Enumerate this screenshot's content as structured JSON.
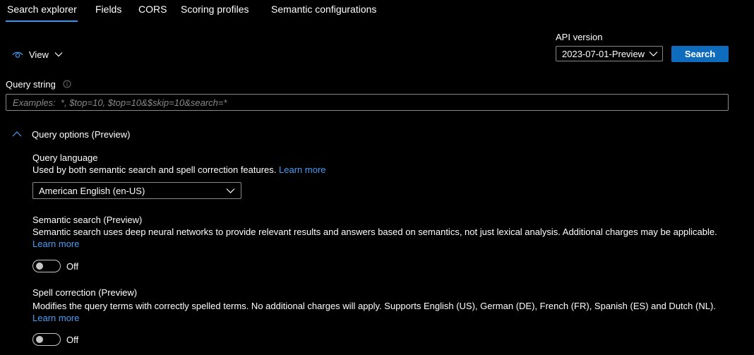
{
  "tabs": [
    {
      "label": "Search explorer",
      "active": true
    },
    {
      "label": "Fields"
    },
    {
      "label": "CORS"
    },
    {
      "label": "Scoring profiles"
    },
    {
      "label": "Semantic configurations"
    }
  ],
  "view": {
    "label": "View",
    "icon": "eye-icon"
  },
  "api": {
    "label": "API version",
    "selected": "2023-07-01-Preview",
    "search_label": "Search"
  },
  "query_string": {
    "label": "Query string",
    "placeholder": "Examples:  *, $top=10, $top=10&$skip=10&search=*"
  },
  "query_options": {
    "title": "Query options (Preview)",
    "language": {
      "title": "Query language",
      "desc": "Used by both semantic search and spell correction features.",
      "link": "Learn more",
      "selected": "American English (en-US)"
    },
    "semantic": {
      "title": "Semantic search (Preview)",
      "desc": "Semantic search uses deep neural networks to provide relevant results and answers based on semantics, not just lexical analysis. Additional charges may be applicable.",
      "link": "Learn more",
      "toggle_label": "Off"
    },
    "spell": {
      "title": "Spell correction (Preview)",
      "desc": "Modifies the query terms with correctly spelled terms. No additional charges will apply. Supports English (US), German (DE), French (FR), Spanish (ES) and Dutch (NL).",
      "link": "Learn more",
      "toggle_label": "Off"
    }
  },
  "colors": {
    "accent": "#2899f5",
    "button": "#0f6cbd",
    "link": "#479ef5",
    "background": "#000000"
  }
}
